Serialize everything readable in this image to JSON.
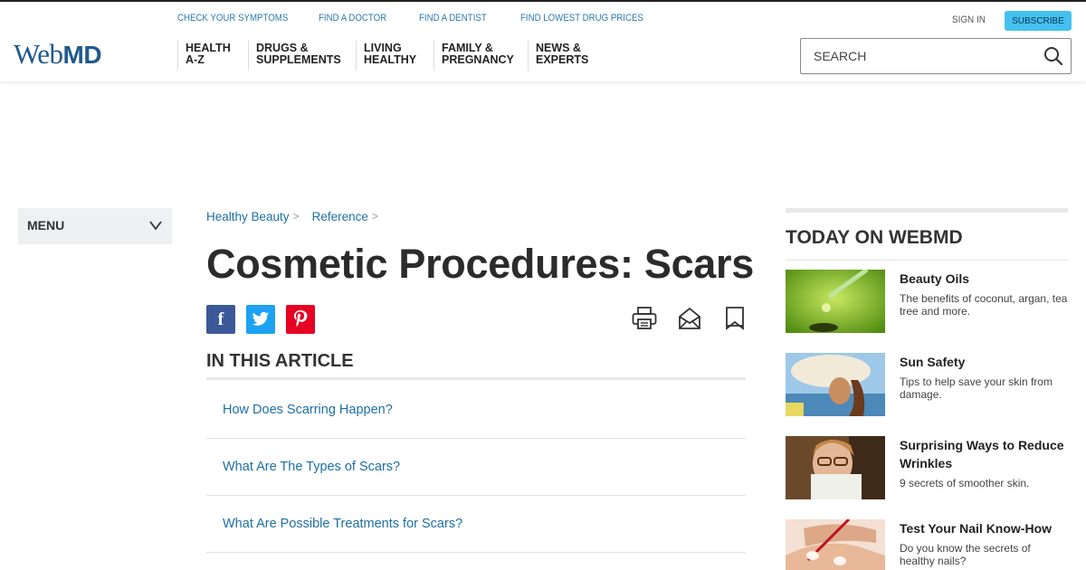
{
  "header": {
    "logo_web": "Web",
    "logo_md": "MD",
    "top_links": [
      "CHECK YOUR SYMPTOMS",
      "FIND A DOCTOR",
      "FIND A DENTIST",
      "FIND LOWEST DRUG PRICES"
    ],
    "sign_in": "SIGN IN",
    "subscribe": "SUBSCRIBE",
    "nav": [
      "HEALTH\nA-Z",
      "DRUGS &\nSUPPLEMENTS",
      "LIVING\nHEALTHY",
      "FAMILY &\nPREGNANCY",
      "NEWS &\nEXPERTS"
    ],
    "search_placeholder": "SEARCH"
  },
  "menu": {
    "label": "MENU"
  },
  "breadcrumb": [
    "Healthy Beauty",
    "Reference"
  ],
  "article": {
    "title": "Cosmetic Procedures: Scars",
    "section_heading": "IN THIS ARTICLE",
    "toc": [
      "How Does Scarring Happen?",
      "What Are The Types of Scars?",
      "What Are Possible Treatments for Scars?"
    ]
  },
  "sidebar": {
    "heading": "TODAY ON WEBMD",
    "items": [
      {
        "title": "Beauty Oils",
        "desc": "The benefits of coconut, argan, tea tree and more."
      },
      {
        "title": "Sun Safety",
        "desc": "Tips to help save your skin from damage."
      },
      {
        "title": "Surprising Ways to Reduce Wrinkles",
        "desc": "9 secrets of smoother skin."
      },
      {
        "title": "Test Your Nail Know-How",
        "desc": "Do you know the secrets of healthy nails?"
      }
    ]
  },
  "colors": {
    "link": "#1d6fa5",
    "brand": "#1f5a8c",
    "subscribe": "#45c1ef",
    "facebook": "#3b5998",
    "twitter": "#1da1f2",
    "pinterest": "#e60023"
  },
  "icons": [
    "search-icon",
    "chevron-down-icon",
    "facebook-icon",
    "twitter-icon",
    "pinterest-icon",
    "print-icon",
    "email-icon",
    "bookmark-icon"
  ]
}
